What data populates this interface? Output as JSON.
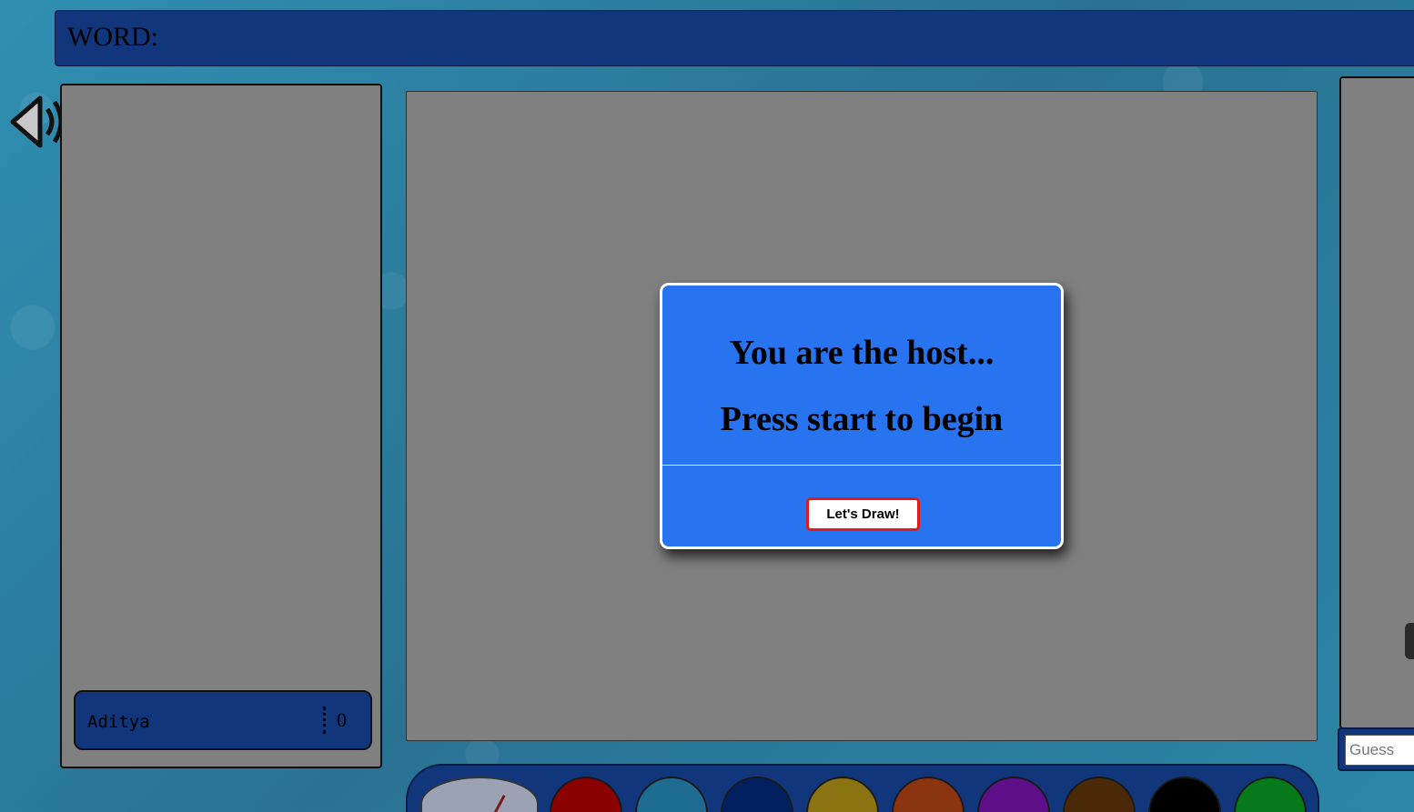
{
  "header": {
    "word_label": "WORD:"
  },
  "sound": {
    "icon": "speaker-volume-icon"
  },
  "players": [
    {
      "name": "Aditya",
      "score": "0"
    }
  ],
  "modal": {
    "line1": "You are the host...",
    "line2": "Press start to begin",
    "button_label": "Let's Draw!"
  },
  "chat": {
    "guess_placeholder": "Guess"
  },
  "palette": {
    "brush_size_icon": "brush-size-dial-icon",
    "colors": [
      {
        "name": "red",
        "hex": "#8b0000"
      },
      {
        "name": "teal",
        "hex": "#1e6c92"
      },
      {
        "name": "navy",
        "hex": "#012060"
      },
      {
        "name": "olive-yellow",
        "hex": "#8a7310"
      },
      {
        "name": "orange",
        "hex": "#8a3510"
      },
      {
        "name": "purple",
        "hex": "#5f0f8a"
      },
      {
        "name": "brown",
        "hex": "#4a2808"
      },
      {
        "name": "black",
        "hex": "#000000"
      },
      {
        "name": "green",
        "hex": "#067a1a"
      }
    ]
  }
}
